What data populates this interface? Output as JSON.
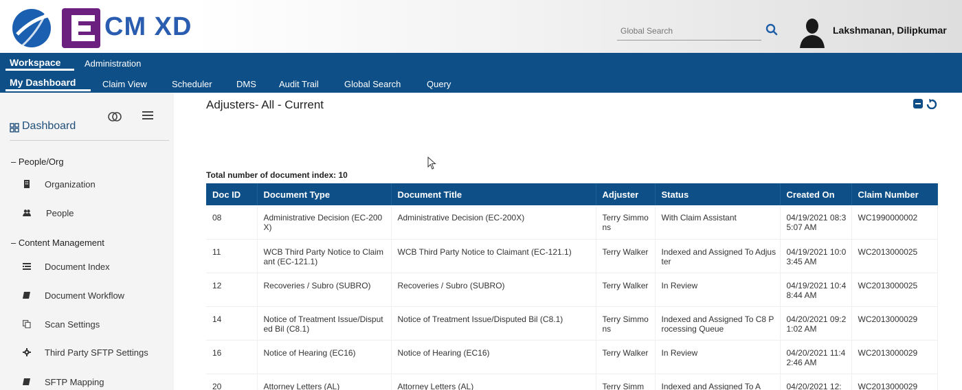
{
  "header": {
    "logo_text": "CM XD",
    "search": {
      "placeholder": "Global Search",
      "value": ""
    },
    "user_name": "Lakshmanan, Dilipkumar"
  },
  "nav_primary": [
    {
      "label": "Workspace",
      "active": true
    },
    {
      "label": "Administration",
      "active": false
    }
  ],
  "nav_secondary": [
    {
      "label": "My Dashboard",
      "active": true
    },
    {
      "label": "Claim View",
      "active": false
    },
    {
      "label": "Scheduler",
      "active": false
    },
    {
      "label": "DMS",
      "active": false
    },
    {
      "label": "Audit Trail",
      "active": false
    },
    {
      "label": "Global Search",
      "active": false
    },
    {
      "label": "Query",
      "active": false
    }
  ],
  "sidebar": {
    "dashboard_label": "Dashboard",
    "sections": [
      {
        "label": "People/Org",
        "items": [
          {
            "label": "Organization",
            "icon": "building-icon"
          },
          {
            "label": "People",
            "icon": "people-icon"
          }
        ]
      },
      {
        "label": "Content Management",
        "items": [
          {
            "label": "Document Index",
            "icon": "list-icon"
          },
          {
            "label": "Document Workflow",
            "icon": "book-icon"
          },
          {
            "label": "Scan Settings",
            "icon": "copy-icon"
          },
          {
            "label": "Third Party SFTP Settings",
            "icon": "gear-icon"
          },
          {
            "label": "SFTP Mapping",
            "icon": "book-icon"
          }
        ]
      }
    ]
  },
  "main": {
    "title": "Adjusters- All - Current",
    "total_label": "Total number of document index: 10",
    "table": {
      "columns": [
        "Doc ID",
        "Document Type",
        "Document Title",
        "Adjuster",
        "Status",
        "Created On",
        "Claim Number"
      ],
      "rows": [
        [
          "08",
          "Administrative Decision (EC-200X)",
          "Administrative Decision (EC-200X)",
          "Terry Simmons",
          "With Claim Assistant",
          "04/19/2021 08:35:07 AM",
          "WC1990000002"
        ],
        [
          "11",
          "WCB Third Party Notice to Claimant (EC-121.1)",
          "WCB Third Party Notice to Claimant (EC-121.1)",
          "Terry Walker",
          "Indexed and Assigned To Adjuster",
          "04/19/2021 10:03:45 AM",
          "WC2013000025"
        ],
        [
          "12",
          "Recoveries / Subro (SUBRO)",
          "Recoveries / Subro (SUBRO)",
          "Terry Walker",
          "In Review",
          "04/19/2021 10:48:44 AM",
          "WC2013000025"
        ],
        [
          "14",
          "Notice of Treatment Issue/Disputed Bil (C8.1)",
          "Notice of Treatment Issue/Disputed Bil (C8.1)",
          "Terry Simmons",
          "Indexed and Assigned To C8 Processing Queue",
          "04/20/2021 09:21:02 AM",
          "WC2013000029"
        ],
        [
          "16",
          "Notice of Hearing (EC16)",
          "Notice of Hearing (EC16)",
          "Terry Walker",
          "In Review",
          "04/20/2021 11:42:46 AM",
          "WC2013000029"
        ],
        [
          "20",
          "Attorney Letters (AL)",
          "Attorney Letters (AL)",
          "Terry Simm",
          "Indexed and Assigned To A",
          "04/20/2021 12:",
          "WC2013000029"
        ]
      ]
    }
  },
  "colors": {
    "nav_bg": "#0e4f87",
    "brand_purple": "#6b1f7e",
    "brand_blue": "#2a5db0"
  }
}
